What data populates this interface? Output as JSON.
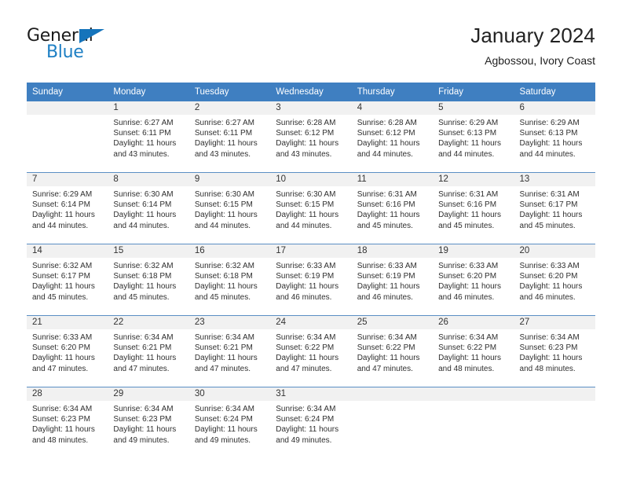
{
  "brand": {
    "name_part1": "General",
    "name_part2": "Blue",
    "triangle_icon": "triangle-icon",
    "accent_color": "#1d7fc4"
  },
  "header": {
    "title": "January 2024",
    "subtitle": "Agbossou, Ivory Coast"
  },
  "theme": {
    "header_bg": "#3f7fc1",
    "daynum_bg": "#f1f1f1",
    "row_divider": "#5b8fc4",
    "text": "#2f2f2f"
  },
  "weekday_headers": [
    "Sunday",
    "Monday",
    "Tuesday",
    "Wednesday",
    "Thursday",
    "Friday",
    "Saturday"
  ],
  "weeks": [
    [
      {
        "day": "",
        "sunrise": "",
        "sunset": "",
        "daylight_line1": "",
        "daylight_line2": ""
      },
      {
        "day": "1",
        "sunrise": "Sunrise: 6:27 AM",
        "sunset": "Sunset: 6:11 PM",
        "daylight_line1": "Daylight: 11 hours",
        "daylight_line2": "and 43 minutes."
      },
      {
        "day": "2",
        "sunrise": "Sunrise: 6:27 AM",
        "sunset": "Sunset: 6:11 PM",
        "daylight_line1": "Daylight: 11 hours",
        "daylight_line2": "and 43 minutes."
      },
      {
        "day": "3",
        "sunrise": "Sunrise: 6:28 AM",
        "sunset": "Sunset: 6:12 PM",
        "daylight_line1": "Daylight: 11 hours",
        "daylight_line2": "and 43 minutes."
      },
      {
        "day": "4",
        "sunrise": "Sunrise: 6:28 AM",
        "sunset": "Sunset: 6:12 PM",
        "daylight_line1": "Daylight: 11 hours",
        "daylight_line2": "and 44 minutes."
      },
      {
        "day": "5",
        "sunrise": "Sunrise: 6:29 AM",
        "sunset": "Sunset: 6:13 PM",
        "daylight_line1": "Daylight: 11 hours",
        "daylight_line2": "and 44 minutes."
      },
      {
        "day": "6",
        "sunrise": "Sunrise: 6:29 AM",
        "sunset": "Sunset: 6:13 PM",
        "daylight_line1": "Daylight: 11 hours",
        "daylight_line2": "and 44 minutes."
      }
    ],
    [
      {
        "day": "7",
        "sunrise": "Sunrise: 6:29 AM",
        "sunset": "Sunset: 6:14 PM",
        "daylight_line1": "Daylight: 11 hours",
        "daylight_line2": "and 44 minutes."
      },
      {
        "day": "8",
        "sunrise": "Sunrise: 6:30 AM",
        "sunset": "Sunset: 6:14 PM",
        "daylight_line1": "Daylight: 11 hours",
        "daylight_line2": "and 44 minutes."
      },
      {
        "day": "9",
        "sunrise": "Sunrise: 6:30 AM",
        "sunset": "Sunset: 6:15 PM",
        "daylight_line1": "Daylight: 11 hours",
        "daylight_line2": "and 44 minutes."
      },
      {
        "day": "10",
        "sunrise": "Sunrise: 6:30 AM",
        "sunset": "Sunset: 6:15 PM",
        "daylight_line1": "Daylight: 11 hours",
        "daylight_line2": "and 44 minutes."
      },
      {
        "day": "11",
        "sunrise": "Sunrise: 6:31 AM",
        "sunset": "Sunset: 6:16 PM",
        "daylight_line1": "Daylight: 11 hours",
        "daylight_line2": "and 45 minutes."
      },
      {
        "day": "12",
        "sunrise": "Sunrise: 6:31 AM",
        "sunset": "Sunset: 6:16 PM",
        "daylight_line1": "Daylight: 11 hours",
        "daylight_line2": "and 45 minutes."
      },
      {
        "day": "13",
        "sunrise": "Sunrise: 6:31 AM",
        "sunset": "Sunset: 6:17 PM",
        "daylight_line1": "Daylight: 11 hours",
        "daylight_line2": "and 45 minutes."
      }
    ],
    [
      {
        "day": "14",
        "sunrise": "Sunrise: 6:32 AM",
        "sunset": "Sunset: 6:17 PM",
        "daylight_line1": "Daylight: 11 hours",
        "daylight_line2": "and 45 minutes."
      },
      {
        "day": "15",
        "sunrise": "Sunrise: 6:32 AM",
        "sunset": "Sunset: 6:18 PM",
        "daylight_line1": "Daylight: 11 hours",
        "daylight_line2": "and 45 minutes."
      },
      {
        "day": "16",
        "sunrise": "Sunrise: 6:32 AM",
        "sunset": "Sunset: 6:18 PM",
        "daylight_line1": "Daylight: 11 hours",
        "daylight_line2": "and 45 minutes."
      },
      {
        "day": "17",
        "sunrise": "Sunrise: 6:33 AM",
        "sunset": "Sunset: 6:19 PM",
        "daylight_line1": "Daylight: 11 hours",
        "daylight_line2": "and 46 minutes."
      },
      {
        "day": "18",
        "sunrise": "Sunrise: 6:33 AM",
        "sunset": "Sunset: 6:19 PM",
        "daylight_line1": "Daylight: 11 hours",
        "daylight_line2": "and 46 minutes."
      },
      {
        "day": "19",
        "sunrise": "Sunrise: 6:33 AM",
        "sunset": "Sunset: 6:20 PM",
        "daylight_line1": "Daylight: 11 hours",
        "daylight_line2": "and 46 minutes."
      },
      {
        "day": "20",
        "sunrise": "Sunrise: 6:33 AM",
        "sunset": "Sunset: 6:20 PM",
        "daylight_line1": "Daylight: 11 hours",
        "daylight_line2": "and 46 minutes."
      }
    ],
    [
      {
        "day": "21",
        "sunrise": "Sunrise: 6:33 AM",
        "sunset": "Sunset: 6:20 PM",
        "daylight_line1": "Daylight: 11 hours",
        "daylight_line2": "and 47 minutes."
      },
      {
        "day": "22",
        "sunrise": "Sunrise: 6:34 AM",
        "sunset": "Sunset: 6:21 PM",
        "daylight_line1": "Daylight: 11 hours",
        "daylight_line2": "and 47 minutes."
      },
      {
        "day": "23",
        "sunrise": "Sunrise: 6:34 AM",
        "sunset": "Sunset: 6:21 PM",
        "daylight_line1": "Daylight: 11 hours",
        "daylight_line2": "and 47 minutes."
      },
      {
        "day": "24",
        "sunrise": "Sunrise: 6:34 AM",
        "sunset": "Sunset: 6:22 PM",
        "daylight_line1": "Daylight: 11 hours",
        "daylight_line2": "and 47 minutes."
      },
      {
        "day": "25",
        "sunrise": "Sunrise: 6:34 AM",
        "sunset": "Sunset: 6:22 PM",
        "daylight_line1": "Daylight: 11 hours",
        "daylight_line2": "and 47 minutes."
      },
      {
        "day": "26",
        "sunrise": "Sunrise: 6:34 AM",
        "sunset": "Sunset: 6:22 PM",
        "daylight_line1": "Daylight: 11 hours",
        "daylight_line2": "and 48 minutes."
      },
      {
        "day": "27",
        "sunrise": "Sunrise: 6:34 AM",
        "sunset": "Sunset: 6:23 PM",
        "daylight_line1": "Daylight: 11 hours",
        "daylight_line2": "and 48 minutes."
      }
    ],
    [
      {
        "day": "28",
        "sunrise": "Sunrise: 6:34 AM",
        "sunset": "Sunset: 6:23 PM",
        "daylight_line1": "Daylight: 11 hours",
        "daylight_line2": "and 48 minutes."
      },
      {
        "day": "29",
        "sunrise": "Sunrise: 6:34 AM",
        "sunset": "Sunset: 6:23 PM",
        "daylight_line1": "Daylight: 11 hours",
        "daylight_line2": "and 49 minutes."
      },
      {
        "day": "30",
        "sunrise": "Sunrise: 6:34 AM",
        "sunset": "Sunset: 6:24 PM",
        "daylight_line1": "Daylight: 11 hours",
        "daylight_line2": "and 49 minutes."
      },
      {
        "day": "31",
        "sunrise": "Sunrise: 6:34 AM",
        "sunset": "Sunset: 6:24 PM",
        "daylight_line1": "Daylight: 11 hours",
        "daylight_line2": "and 49 minutes."
      },
      {
        "day": "",
        "sunrise": "",
        "sunset": "",
        "daylight_line1": "",
        "daylight_line2": ""
      },
      {
        "day": "",
        "sunrise": "",
        "sunset": "",
        "daylight_line1": "",
        "daylight_line2": ""
      },
      {
        "day": "",
        "sunrise": "",
        "sunset": "",
        "daylight_line1": "",
        "daylight_line2": ""
      }
    ]
  ]
}
